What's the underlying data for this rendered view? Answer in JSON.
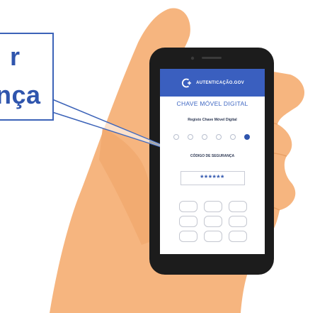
{
  "callout": {
    "line1": "r",
    "line2": "nça"
  },
  "phone": {
    "header": {
      "app_name": "AUTENTICAÇÃO.GOV",
      "logo_icon": "plus-c-logo-icon"
    },
    "title": "CHAVE MÓVEL DIGITAL",
    "subtitle": "Registo Chave Móvel Digital",
    "steps": {
      "total": 6,
      "active": 6
    },
    "code_label": "CÓDIGO DE SEGURANÇA",
    "code_value": "******",
    "keypad": {
      "rows": 3,
      "cols": 3
    }
  },
  "colors": {
    "accent": "#3a5fbf",
    "skin": "#f4b27c",
    "phone_body": "#1c1c1c",
    "callout_border": "#3c63b8"
  }
}
